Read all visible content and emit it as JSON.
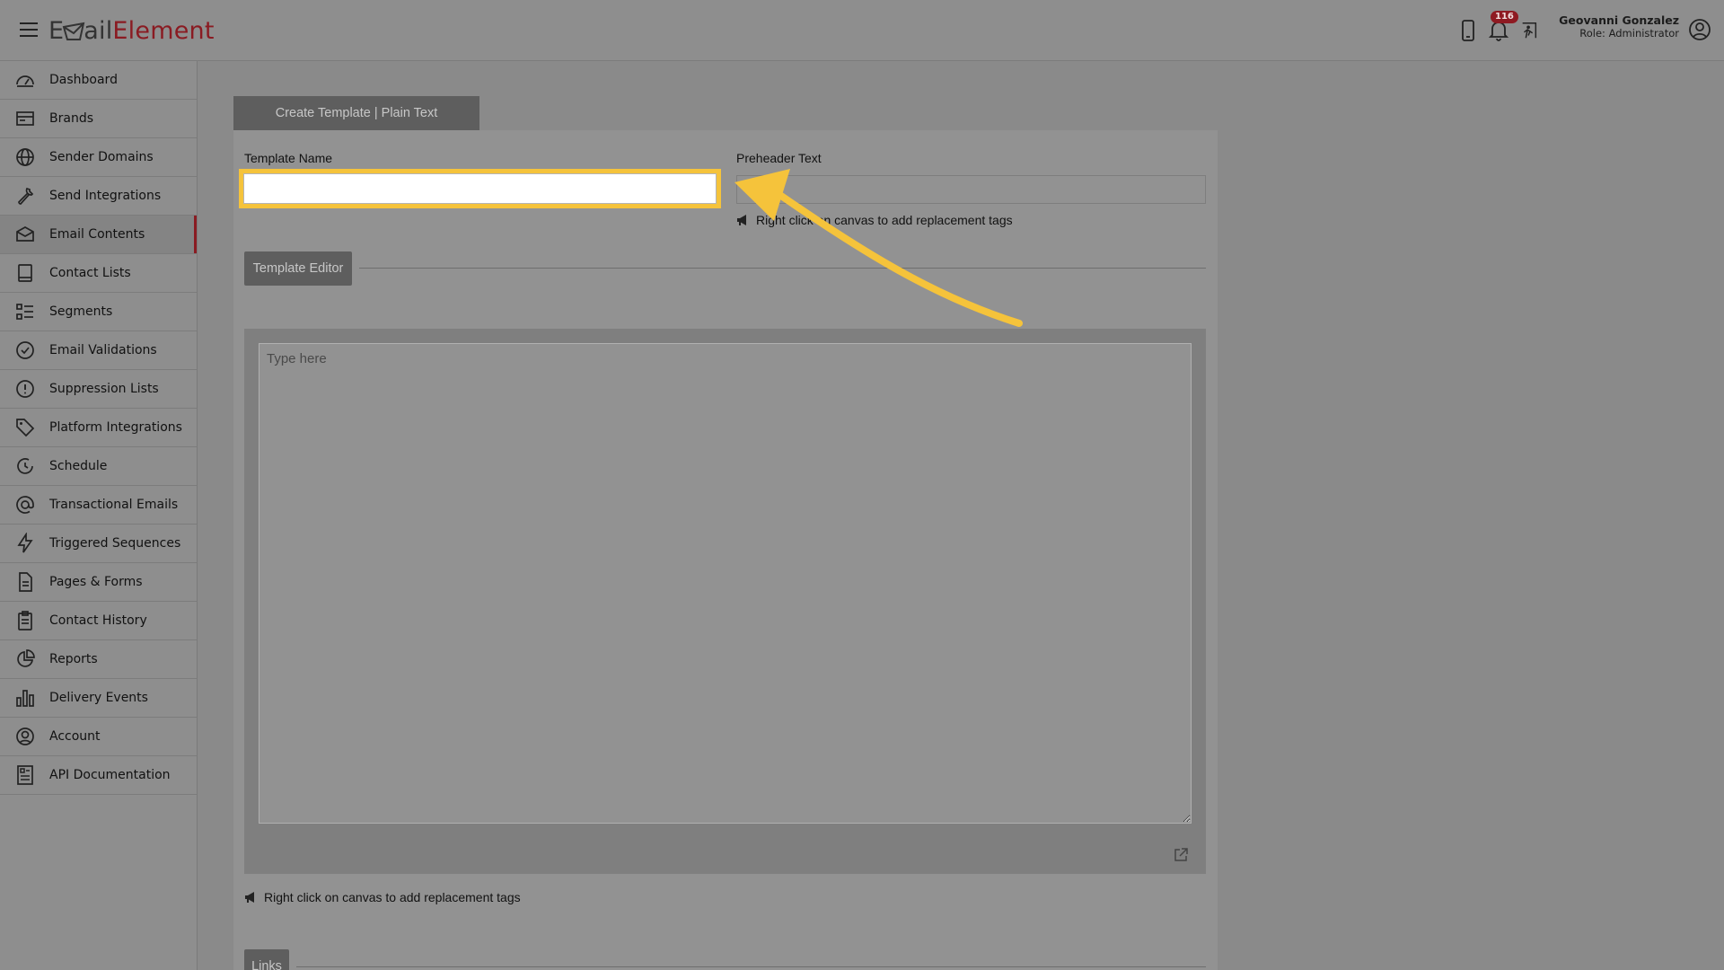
{
  "app": {
    "logo_text_1": "E",
    "logo_text_2": "ail",
    "logo_text_3": "Element",
    "notification_count": "116",
    "colors": {
      "accent": "#8a1b22",
      "highlight": "#f5c33b"
    }
  },
  "user": {
    "name": "Geovanni Gonzalez",
    "role": "Role: Administrator"
  },
  "sidebar": {
    "items": [
      {
        "label": "Dashboard",
        "icon": "dashboard-icon"
      },
      {
        "label": "Brands",
        "icon": "brands-icon"
      },
      {
        "label": "Sender Domains",
        "icon": "globe-icon"
      },
      {
        "label": "Send Integrations",
        "icon": "wrench-icon"
      },
      {
        "label": "Email Contents",
        "icon": "envelope-icon",
        "active": true
      },
      {
        "label": "Contact Lists",
        "icon": "book-icon"
      },
      {
        "label": "Segments",
        "icon": "list-icon"
      },
      {
        "label": "Email Validations",
        "icon": "check-circle-icon"
      },
      {
        "label": "Suppression Lists",
        "icon": "alert-circle-icon"
      },
      {
        "label": "Platform Integrations",
        "icon": "tag-icon"
      },
      {
        "label": "Schedule",
        "icon": "clock-icon"
      },
      {
        "label": "Transactional Emails",
        "icon": "at-icon"
      },
      {
        "label": "Triggered Sequences",
        "icon": "lightning-icon"
      },
      {
        "label": "Pages & Forms",
        "icon": "file-icon"
      },
      {
        "label": "Contact History",
        "icon": "clipboard-icon"
      },
      {
        "label": "Reports",
        "icon": "pie-chart-icon"
      },
      {
        "label": "Delivery Events",
        "icon": "bar-chart-icon"
      },
      {
        "label": "Account",
        "icon": "user-circle-icon"
      },
      {
        "label": "API Documentation",
        "icon": "document-icon"
      }
    ]
  },
  "main": {
    "tab_title": "Create Template | Plain Text",
    "template_name_label": "Template Name",
    "template_name_value": "",
    "preheader_label": "Preheader Text",
    "preheader_value": "",
    "preheader_hint": "Right click on canvas to add replacement tags",
    "editor_button": "Template Editor",
    "editor_placeholder": "Type here",
    "editor_hint": "Right click on canvas to add replacement tags",
    "links_button": "Links"
  }
}
